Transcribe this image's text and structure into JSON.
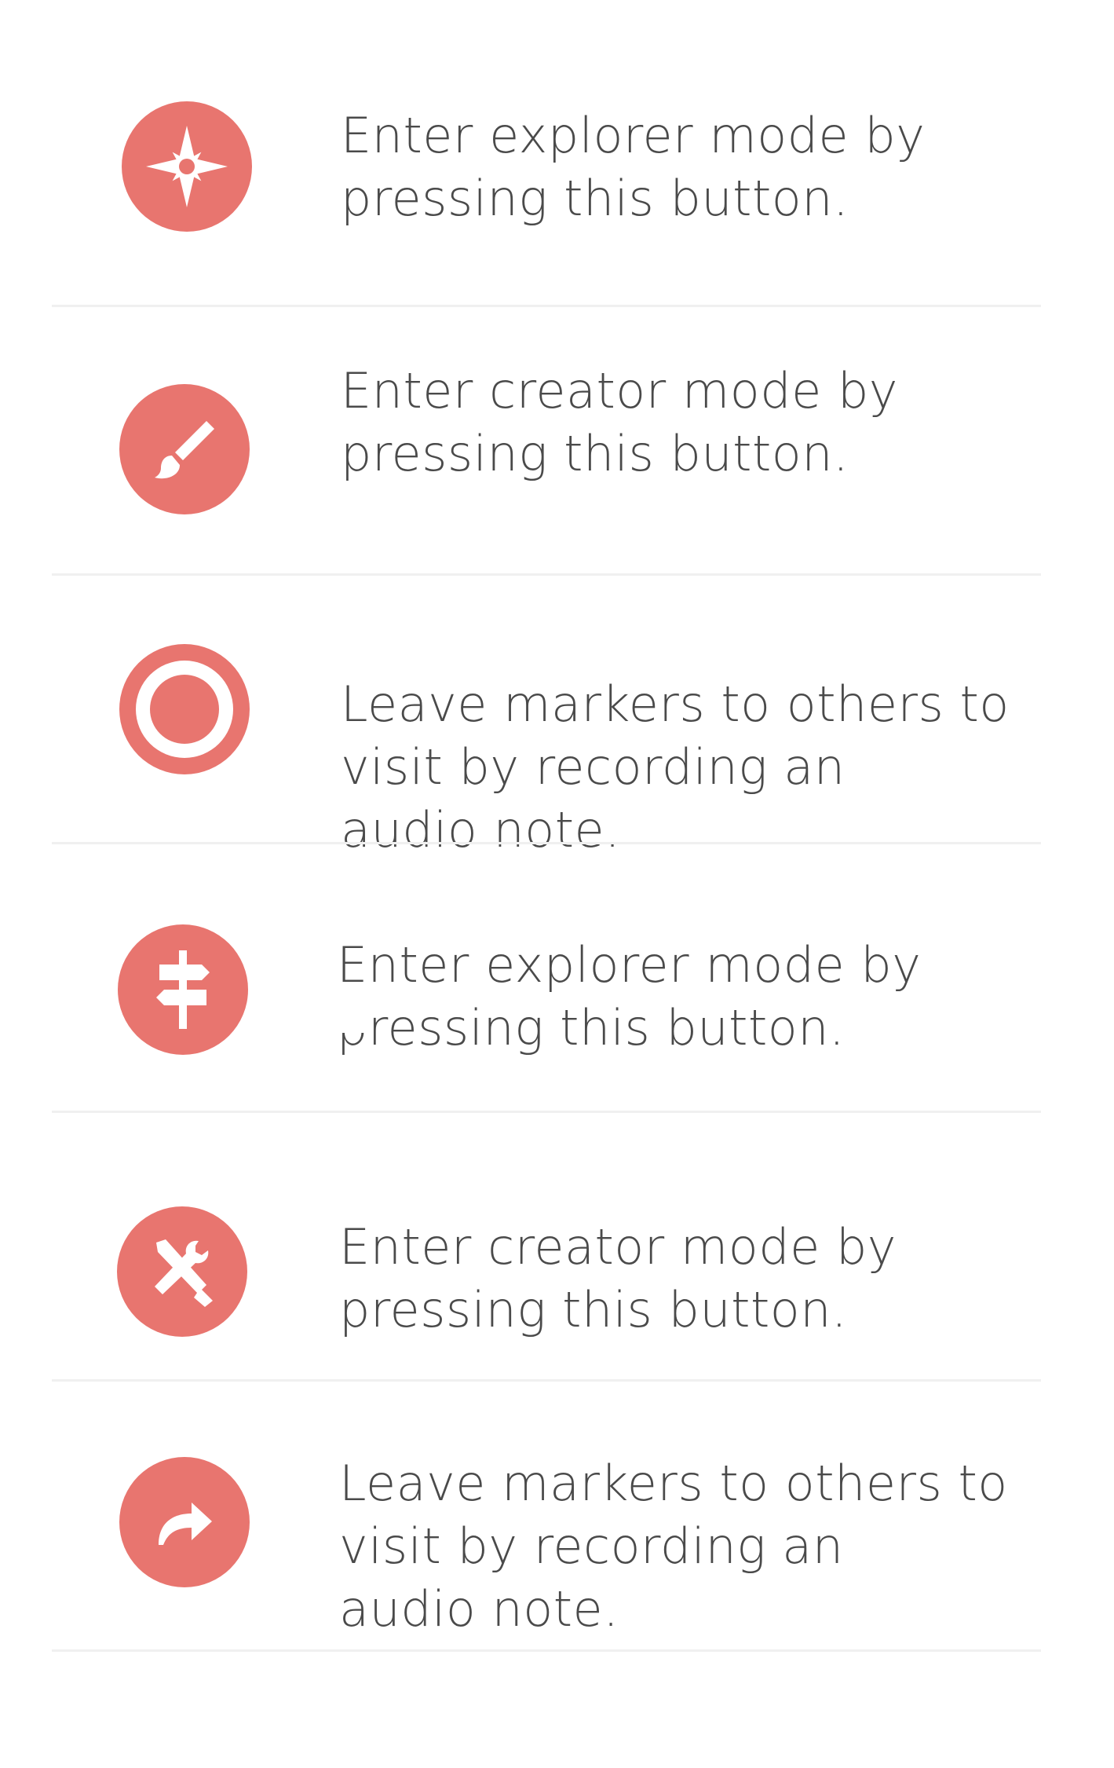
{
  "theme": {
    "accent": "#e8756f",
    "text_color": "#4a4a4a",
    "divider_color": "#f0f0f0"
  },
  "rows": [
    {
      "icon": "compass-icon",
      "text": "Enter explorer mode by\npressing this button."
    },
    {
      "icon": "paintbrush-icon",
      "text": "Enter creator mode by\npressing this button."
    },
    {
      "icon": "record-icon",
      "text": "Leave markers to others to\nvisit by recording an\naudio note."
    },
    {
      "icon": "signpost-icon",
      "text": "Enter explorer mode by\npressing this button."
    },
    {
      "icon": "tools-icon",
      "text": "Enter creator mode by\npressing this button."
    },
    {
      "icon": "share-arrow-icon",
      "text": "Leave markers to others to\nvisit by recording an\naudio note."
    }
  ]
}
